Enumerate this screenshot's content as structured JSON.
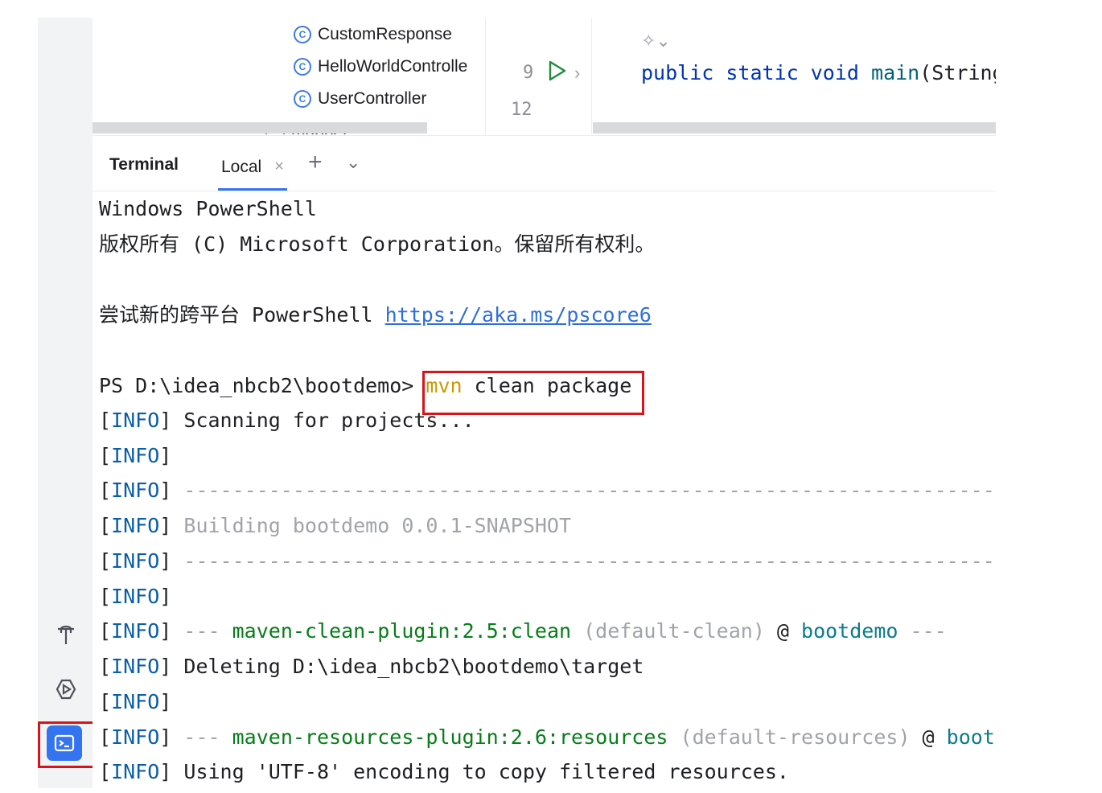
{
  "project_tree": {
    "items": [
      "CustomResponse",
      "HelloWorldControlle",
      "UserController"
    ],
    "class_icon_glyph": "C",
    "partial_folder": "mapper"
  },
  "editor": {
    "line_numbers": [
      "9",
      "12"
    ],
    "code": {
      "kw1": "public",
      "kw2": "static",
      "kw3": "void",
      "fn": "main",
      "rest": "(String"
    }
  },
  "terminal": {
    "title": "Terminal",
    "tab_label": "Local",
    "tab_close": "×",
    "add_tab": "+",
    "menu": "⌄",
    "lines": {
      "l1": "Windows PowerShell",
      "l2": "版权所有 (C) Microsoft Corporation。保留所有权利。",
      "l3_text": "尝试新的跨平台 PowerShell ",
      "l3_link": "https://aka.ms/pscore6",
      "prompt": "PS D:\\idea_nbcb2\\bootdemo> ",
      "cmd_mvn": "mvn",
      "cmd_rest": " clean package",
      "bl": "[",
      "info": "INFO",
      "br": "]",
      "scanning": " Scanning for projects...",
      "dashes": " -------------------------------------------------------------------",
      "building": " Building bootdemo 0.0.1-SNAPSHOT",
      "sep": " --- ",
      "clean_plugin": "maven-clean-plugin:2.5:clean",
      "clean_exec": " (default-clean)",
      "at": " @ ",
      "project": "bootdemo",
      "tail_sep": " ---",
      "deleting": " Deleting D:\\idea_nbcb2\\bootdemo\\target",
      "res_plugin": "maven-resources-plugin:2.6:resources",
      "res_exec": " (default-resources)",
      "project_cut": "boot",
      "encoding": " Using 'UTF-8' encoding to copy filtered resources."
    }
  },
  "colors": {
    "accent": "#3574f0",
    "highlight": "#d7141a",
    "info": "#0a5ea8",
    "plugin": "#067d17"
  },
  "icons": [
    "class-icon",
    "folder-icon",
    "run-icon",
    "ai-assistant-icon",
    "build-icon",
    "services-icon",
    "terminal-icon"
  ]
}
